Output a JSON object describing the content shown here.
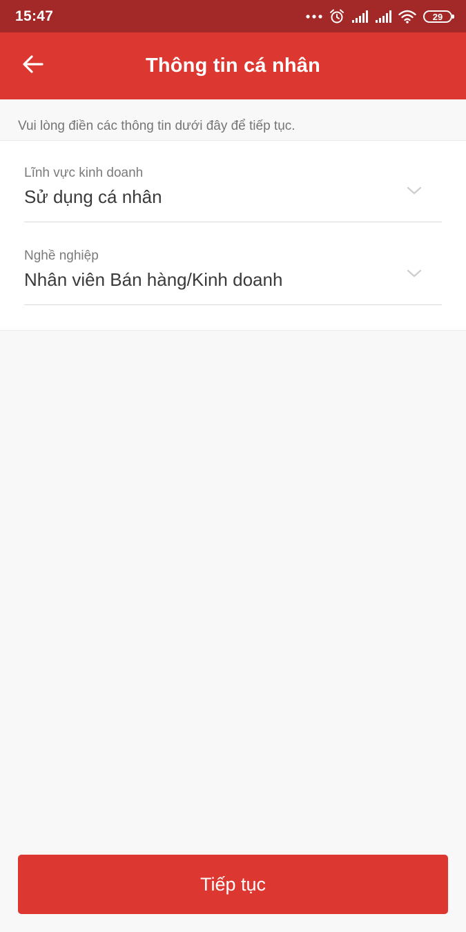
{
  "status_bar": {
    "time": "15:47",
    "battery_level": "29",
    "icons": [
      "more-dots-icon",
      "alarm-icon",
      "signal-icon",
      "signal-icon",
      "wifi-icon",
      "battery-icon"
    ]
  },
  "app_bar": {
    "title": "Thông tin cá nhân",
    "back_icon": "arrow-left-icon"
  },
  "instruction": "Vui lòng điền các thông tin dưới đây để tiếp tục.",
  "form": {
    "fields": [
      {
        "label": "Lĩnh vực kinh doanh",
        "value": "Sử dụng cá nhân",
        "icon": "chevron-down-icon"
      },
      {
        "label": "Nghề nghiệp",
        "value": "Nhân viên Bán hàng/Kinh doanh",
        "icon": "chevron-down-icon"
      }
    ]
  },
  "actions": {
    "continue_label": "Tiếp tục"
  },
  "colors": {
    "status_bar": "#a32828",
    "primary": "#dd3731",
    "background": "#f8f8f8",
    "label": "#7a7a7a",
    "value": "#3a3a3a"
  }
}
